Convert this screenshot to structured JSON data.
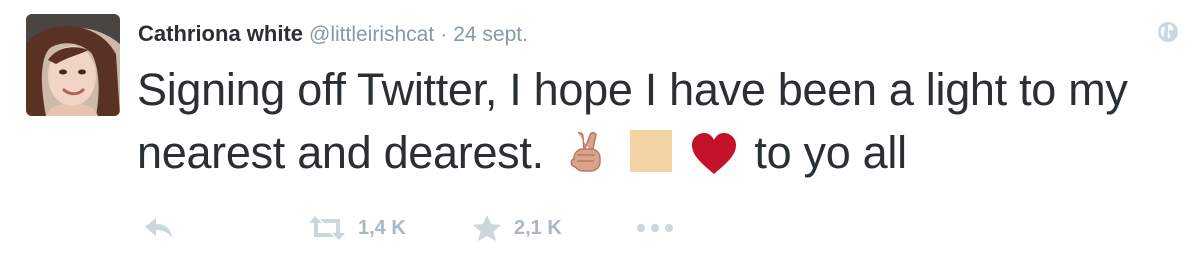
{
  "tweet": {
    "display_name": "Cathriona white",
    "handle": "@littleirishcat",
    "separator": "·",
    "date": "24 sept.",
    "text_part1": "Signing off Twitter, I hope I have been a light to my nearest and dearest.",
    "text_part2": "to yo all",
    "emojis": [
      "victory-hand",
      "skin-tone-square",
      "red-heart"
    ]
  },
  "actions": {
    "retweet_count": "1,4 K",
    "favorite_count": "2,1 K"
  },
  "colors": {
    "name": "#292f33",
    "muted": "#8899a6",
    "action_icon": "#aab8c2",
    "heart": "#c3122a",
    "skin_square": "#f2d3a4"
  }
}
